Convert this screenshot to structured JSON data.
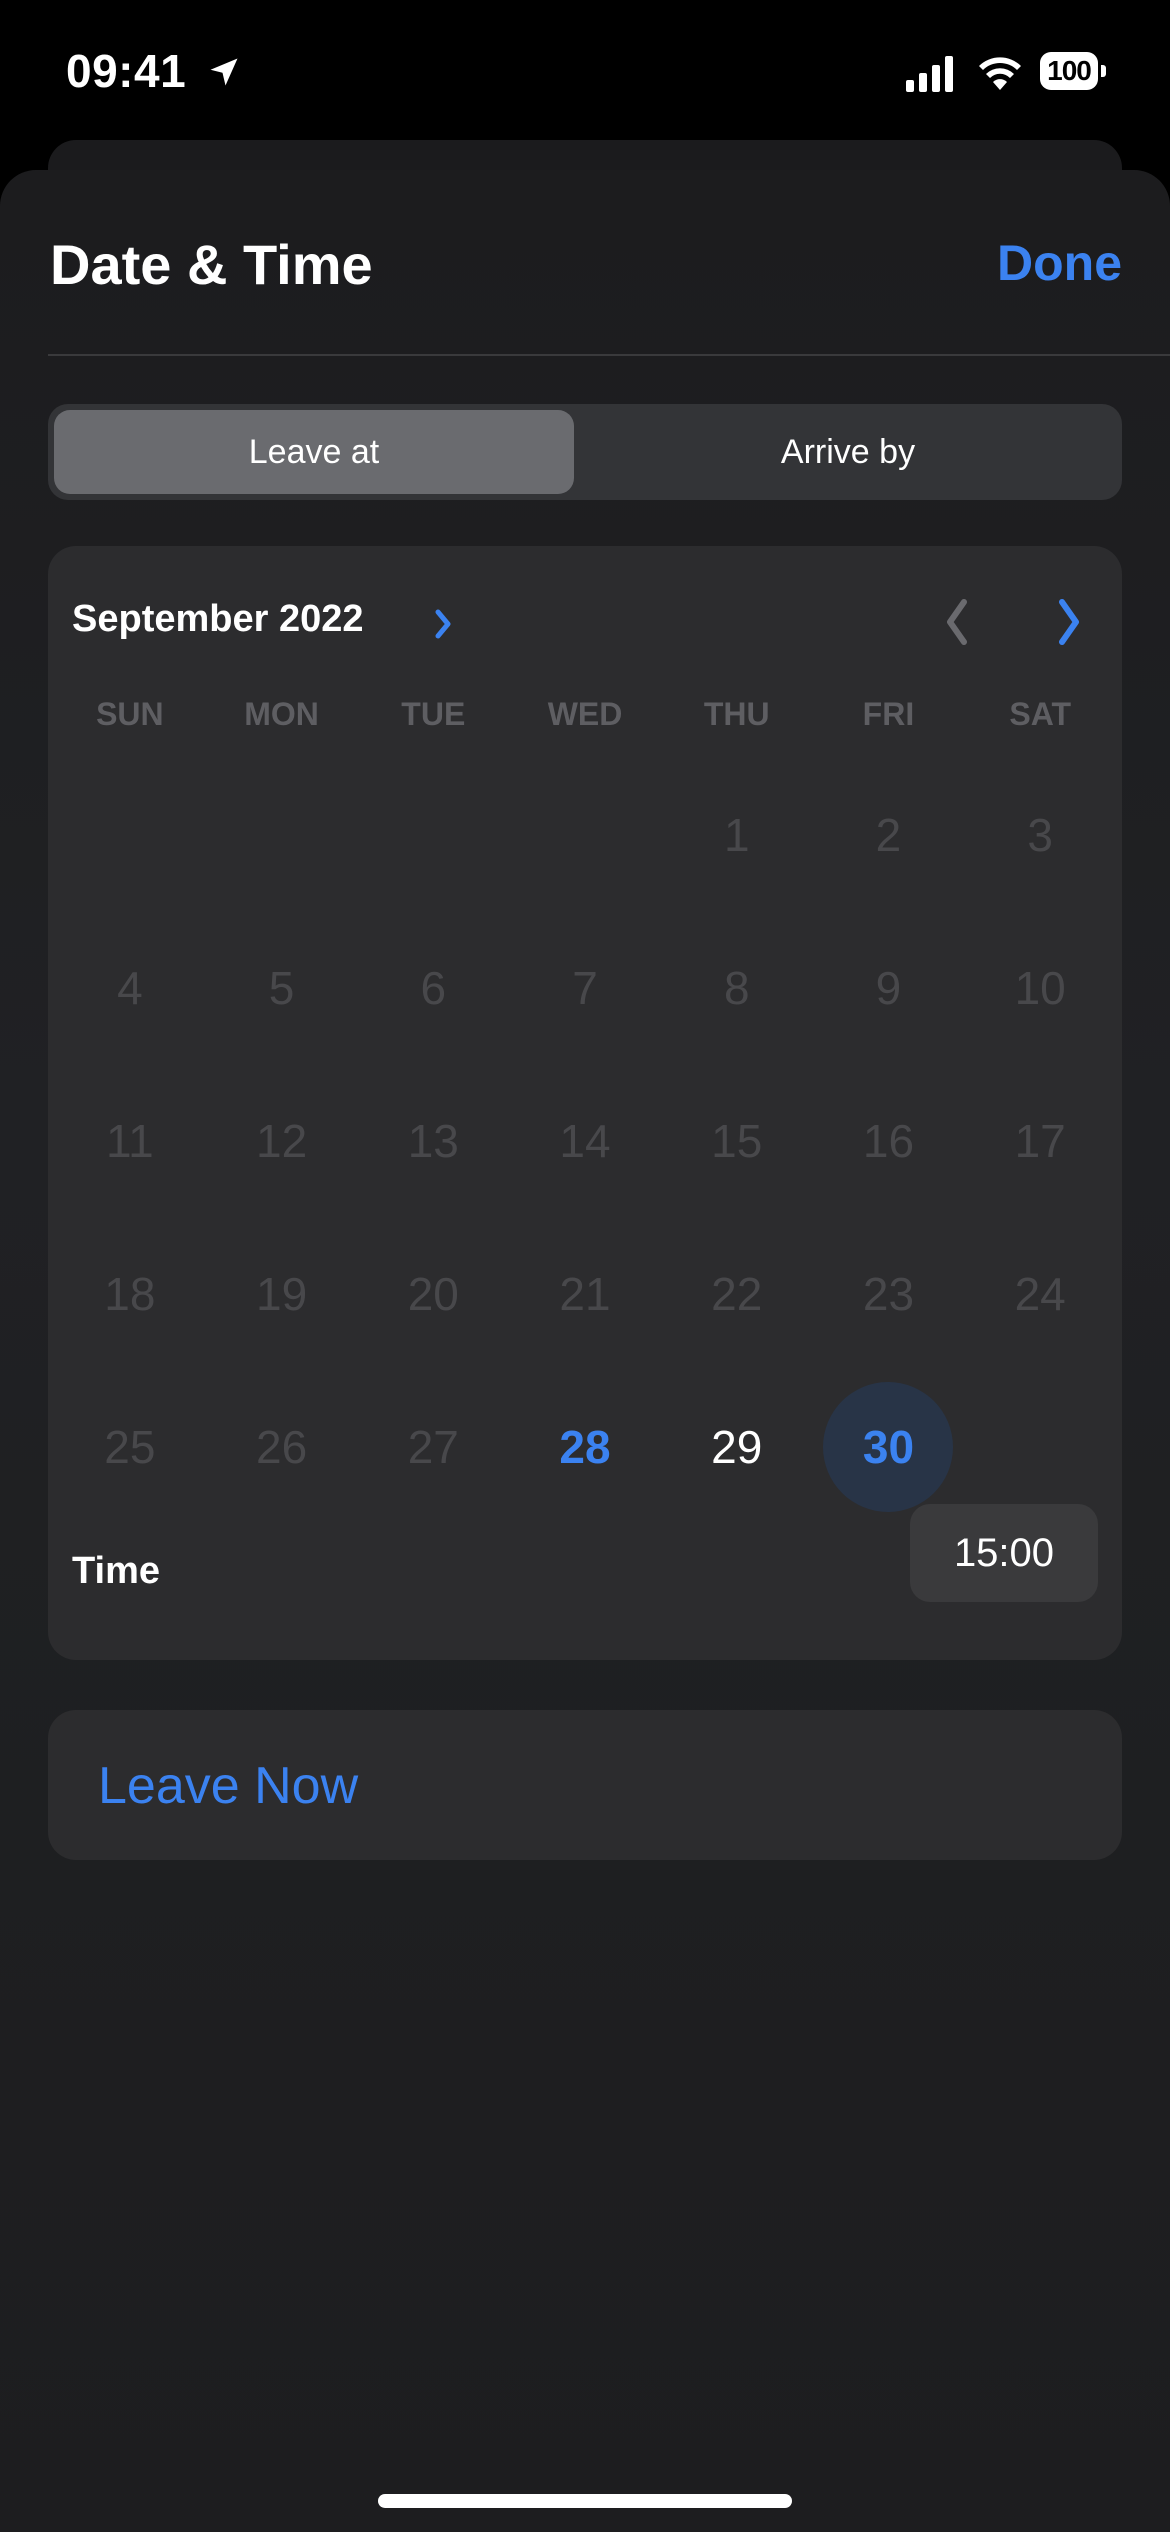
{
  "status_bar": {
    "time": "09:41",
    "location_icon": "location-arrow-icon",
    "signal_icon": "cellular-signal-icon",
    "wifi_icon": "wifi-icon",
    "battery_level": "100"
  },
  "sheet": {
    "title": "Date & Time",
    "done_label": "Done"
  },
  "segmented_control": {
    "options": [
      {
        "label": "Leave at",
        "selected": true
      },
      {
        "label": "Arrive by",
        "selected": false
      }
    ]
  },
  "calendar": {
    "month_label": "September 2022",
    "weekdays": [
      "SUN",
      "MON",
      "TUE",
      "WED",
      "THU",
      "FRI",
      "SAT"
    ],
    "weeks": [
      [
        "",
        "",
        "",
        "",
        "1",
        "2",
        "3"
      ],
      [
        "4",
        "5",
        "6",
        "7",
        "8",
        "9",
        "10"
      ],
      [
        "11",
        "12",
        "13",
        "14",
        "15",
        "16",
        "17"
      ],
      [
        "18",
        "19",
        "20",
        "21",
        "22",
        "23",
        "24"
      ],
      [
        "25",
        "26",
        "27",
        "28",
        "29",
        "30",
        ""
      ]
    ],
    "today": "28",
    "selected": "30",
    "available": [
      "28",
      "29",
      "30"
    ],
    "time_label": "Time",
    "time_value": "15:00"
  },
  "leave_now_label": "Leave Now",
  "colors": {
    "accent": "#3b82f0",
    "background": "#1c1c1e",
    "card": "#2c2c2e",
    "disabled_text": "#48484b"
  }
}
